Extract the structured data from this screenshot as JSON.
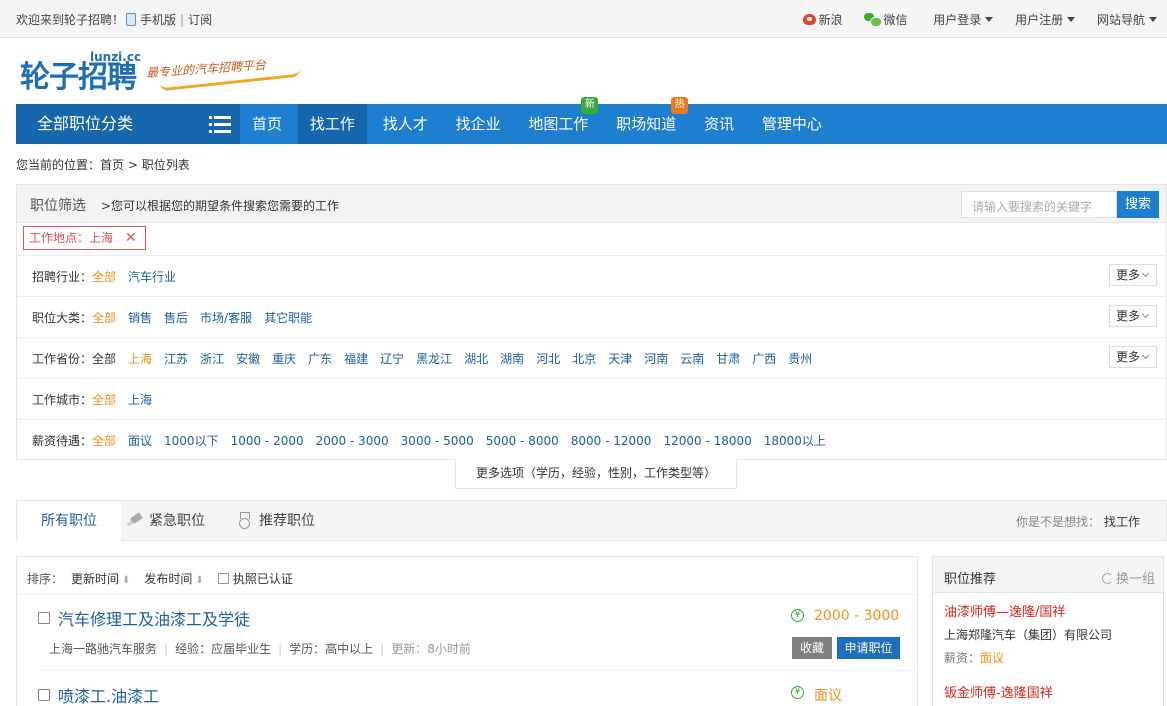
{
  "topbar": {
    "welcome": "欢迎来到轮子招聘！",
    "mobile": "手机版",
    "subscribe": "订阅",
    "weibo": "新浪",
    "wechat": "微信",
    "login": "用户登录",
    "register": "用户注册",
    "sitenav": "网站导航"
  },
  "logo": {
    "name": "轮子招聘",
    "domain": "lunzi.cc",
    "slogan": "最专业的汽车招聘平台"
  },
  "nav": {
    "all_categories": "全部职位分类",
    "items": [
      {
        "label": "首页"
      },
      {
        "label": "找工作"
      },
      {
        "label": "找人才"
      },
      {
        "label": "找企业"
      },
      {
        "label": "地图工作",
        "badge": "新"
      },
      {
        "label": "职场知道",
        "badge": "热"
      },
      {
        "label": "资讯"
      },
      {
        "label": "管理中心"
      }
    ]
  },
  "breadcrumb": {
    "prefix": "您当前的位置：",
    "home": "首页",
    "sep": ">",
    "current": "职位列表"
  },
  "filter": {
    "title": "职位筛选",
    "desc": ">您可以根据您的期望条件搜索您需要的工作",
    "search_placeholder": "请输入要搜索的关键字",
    "search_button": "搜索",
    "active_tag": "工作地点：上海",
    "more_label": "更多",
    "rows": {
      "industry": {
        "label": "招聘行业：",
        "options": [
          "全部",
          "汽车行业"
        ]
      },
      "category": {
        "label": "职位大类：",
        "options": [
          "全部",
          "销售",
          "售后",
          "市场/客服",
          "其它职能"
        ]
      },
      "province": {
        "label": "工作省份：",
        "options": [
          "全部",
          "上海",
          "江苏",
          "浙江",
          "安徽",
          "重庆",
          "广东",
          "福建",
          "辽宁",
          "黑龙江",
          "湖北",
          "湖南",
          "河北",
          "北京",
          "天津",
          "河南",
          "云南",
          "甘肃",
          "广西",
          "贵州"
        ]
      },
      "city": {
        "label": "工作城市：",
        "options": [
          "全部",
          "上海"
        ]
      },
      "salary": {
        "label": "薪资待遇：",
        "options": [
          "全部",
          "面议",
          "1000以下",
          "1000 - 2000",
          "2000 - 3000",
          "3000 - 5000",
          "5000 - 8000",
          "8000 - 12000",
          "12000 - 18000",
          "18000以上"
        ]
      }
    },
    "more_options": "更多选项（学历，经验，性别，工作类型等）"
  },
  "tabs": {
    "all": "所有职位",
    "urgent": "紧急职位",
    "recommended": "推荐职位",
    "hint_prefix": "你是不是想找：",
    "hint_value": "找工作"
  },
  "joblist": {
    "sort_label": "排序：",
    "sort_update": "更新时间",
    "sort_publish": "发布时间",
    "license_verified": "执照已认证",
    "fav_button": "收藏",
    "apply_button": "申请职位",
    "jobs": [
      {
        "title": "汽车修理工及油漆工及学徒",
        "salary": "2000 - 3000",
        "company": "上海一路驰汽车服务",
        "experience": "经验：应届毕业生",
        "education": "学历：高中以上",
        "updated": "更新：8小时前"
      },
      {
        "title": "喷漆工.油漆工",
        "salary": "面议"
      }
    ]
  },
  "side": {
    "title": "职位推荐",
    "refresh": "换一组",
    "salary_label": "薪资：",
    "items": [
      {
        "title": "油漆师傅—逸隆/国祥",
        "company": "上海郑隆汽车（集团）有限公司",
        "salary": "面议"
      },
      {
        "title": "钣金师傅-逸隆国祥"
      }
    ]
  },
  "colors": {
    "primary": "#1e7fd1",
    "primary_dark": "#1566ad",
    "accent_orange": "#f08f18",
    "link_blue": "#1a5fa8",
    "red": "#d9261c"
  }
}
